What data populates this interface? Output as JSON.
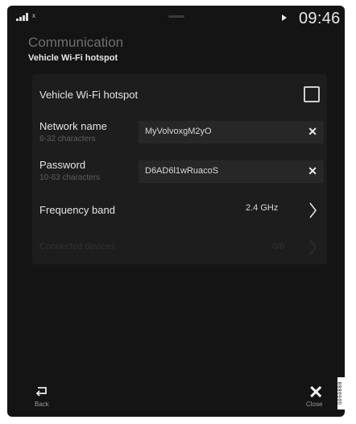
{
  "status_bar": {
    "network_indicator": "x",
    "time": "09:46"
  },
  "header": {
    "app_title": "Communication",
    "page_title": "Vehicle Wi-Fi hotspot"
  },
  "settings": {
    "hotspot_toggle": {
      "label": "Vehicle Wi-Fi hotspot",
      "checked": false
    },
    "network_name": {
      "label": "Network name",
      "hint": "6-32 characters",
      "value": "MyVolvoxgM2yO"
    },
    "password": {
      "label": "Password",
      "hint": "10-63 characters",
      "value": "D6AD6l1wRuacoS"
    },
    "frequency_band": {
      "label": "Frequency band",
      "value": "2.4 GHz"
    },
    "disabled_row": {
      "label": "Connected devices",
      "value": "0/8"
    }
  },
  "footer": {
    "back_label": "Back",
    "close_label": "Close"
  },
  "reference_code": "G050888",
  "colors": {
    "screen_bg": "#141414",
    "panel_bg": "#1d1d1d",
    "field_bg": "#272727",
    "text_primary": "#e4e4e4",
    "text_secondary": "#5d5d5d"
  }
}
